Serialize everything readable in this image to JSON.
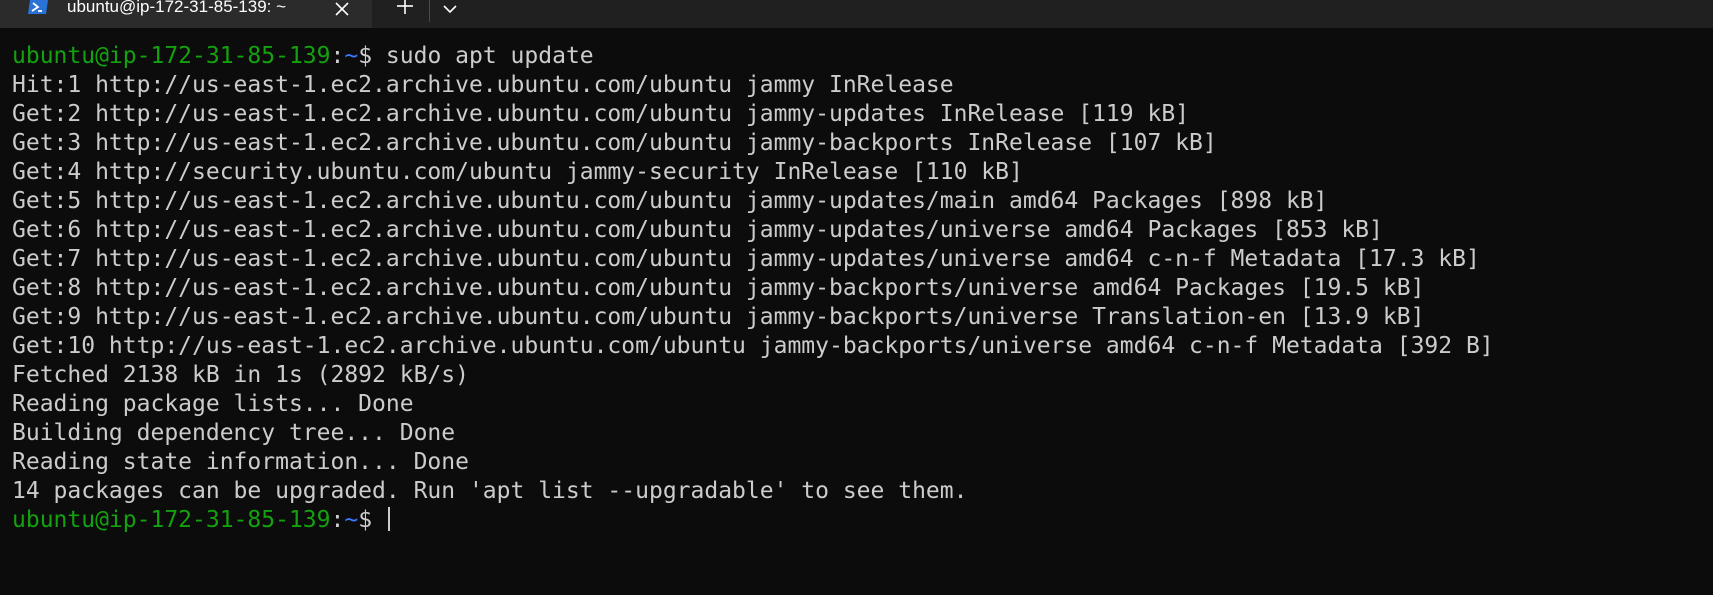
{
  "tab": {
    "title": "ubuntu@ip-172-31-85-139: ~",
    "icon": "powershell-icon",
    "close_icon": "close-icon",
    "new_tab_icon": "plus-icon",
    "dropdown_icon": "chevron-down-icon"
  },
  "colors": {
    "background": "#0c0c0c",
    "tabbar": "#202020",
    "active_tab": "#2b2b2b",
    "text": "#cccccc",
    "prompt_user": "#13a10e",
    "prompt_path": "#3b78ff"
  },
  "terminal": {
    "prompt": {
      "user_host": "ubuntu@ip-172-31-85-139",
      "colon": ":",
      "path": "~",
      "dollar": "$"
    },
    "command": " sudo apt update",
    "output": [
      "Hit:1 http://us-east-1.ec2.archive.ubuntu.com/ubuntu jammy InRelease",
      "Get:2 http://us-east-1.ec2.archive.ubuntu.com/ubuntu jammy-updates InRelease [119 kB]",
      "Get:3 http://us-east-1.ec2.archive.ubuntu.com/ubuntu jammy-backports InRelease [107 kB]",
      "Get:4 http://security.ubuntu.com/ubuntu jammy-security InRelease [110 kB]",
      "Get:5 http://us-east-1.ec2.archive.ubuntu.com/ubuntu jammy-updates/main amd64 Packages [898 kB]",
      "Get:6 http://us-east-1.ec2.archive.ubuntu.com/ubuntu jammy-updates/universe amd64 Packages [853 kB]",
      "Get:7 http://us-east-1.ec2.archive.ubuntu.com/ubuntu jammy-updates/universe amd64 c-n-f Metadata [17.3 kB]",
      "Get:8 http://us-east-1.ec2.archive.ubuntu.com/ubuntu jammy-backports/universe amd64 Packages [19.5 kB]",
      "Get:9 http://us-east-1.ec2.archive.ubuntu.com/ubuntu jammy-backports/universe Translation-en [13.9 kB]",
      "Get:10 http://us-east-1.ec2.archive.ubuntu.com/ubuntu jammy-backports/universe amd64 c-n-f Metadata [392 B]",
      "Fetched 2138 kB in 1s (2892 kB/s)",
      "Reading package lists... Done",
      "Building dependency tree... Done",
      "Reading state information... Done",
      "14 packages can be upgraded. Run 'apt list --upgradable' to see them."
    ],
    "final_input": " "
  }
}
